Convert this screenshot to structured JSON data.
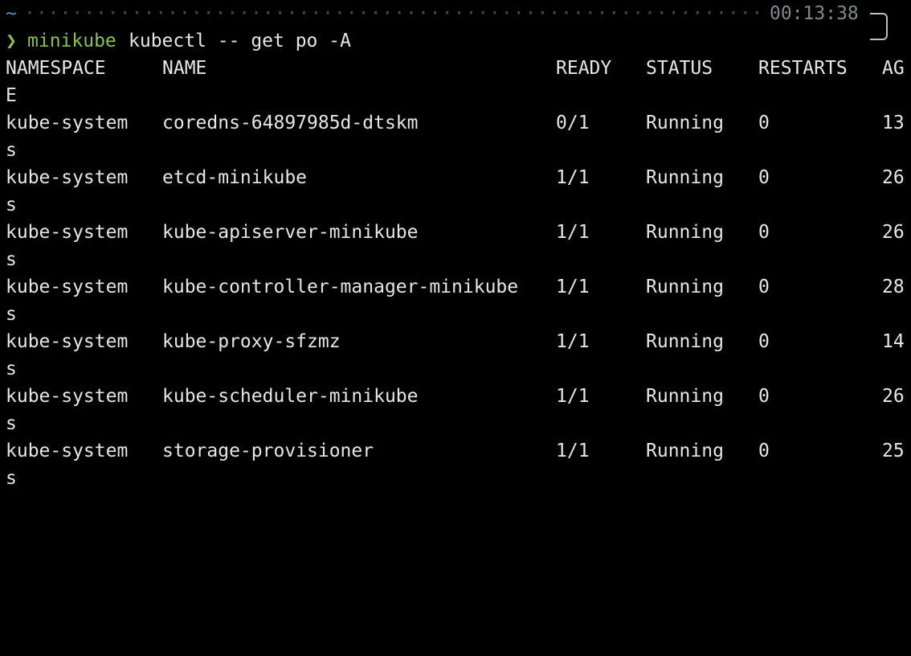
{
  "prompt": {
    "tilde": "~",
    "dots": "···································································································",
    "time": "00:13:38",
    "arrow": "❯",
    "context": "minikube",
    "command": "kubectl -- get po -A"
  },
  "columns": {
    "namespace": "NAMESPACE",
    "name": "NAME",
    "ready": "READY",
    "status": "STATUS",
    "restarts": "RESTARTS",
    "age": "AG",
    "age_wrap": "E"
  },
  "rows": [
    {
      "namespace": "kube-system",
      "name": "coredns-64897985d-dtskm",
      "ready": "0/1",
      "status": "Running",
      "restarts": "0",
      "age": "13",
      "wrap": "s"
    },
    {
      "namespace": "kube-system",
      "name": "etcd-minikube",
      "ready": "1/1",
      "status": "Running",
      "restarts": "0",
      "age": "26",
      "wrap": "s"
    },
    {
      "namespace": "kube-system",
      "name": "kube-apiserver-minikube",
      "ready": "1/1",
      "status": "Running",
      "restarts": "0",
      "age": "26",
      "wrap": "s"
    },
    {
      "namespace": "kube-system",
      "name": "kube-controller-manager-minikube",
      "ready": "1/1",
      "status": "Running",
      "restarts": "0",
      "age": "28",
      "wrap": "s"
    },
    {
      "namespace": "kube-system",
      "name": "kube-proxy-sfzmz",
      "ready": "1/1",
      "status": "Running",
      "restarts": "0",
      "age": "14",
      "wrap": "s"
    },
    {
      "namespace": "kube-system",
      "name": "kube-scheduler-minikube",
      "ready": "1/1",
      "status": "Running",
      "restarts": "0",
      "age": "26",
      "wrap": "s"
    },
    {
      "namespace": "kube-system",
      "name": "storage-provisioner",
      "ready": "1/1",
      "status": "Running",
      "restarts": "0",
      "age": "25",
      "wrap": "s"
    }
  ],
  "colors": {
    "background": "#000000",
    "text": "#e6e6e6",
    "prompt_accent": "#8bc34a",
    "tilde": "#5b8fc4",
    "time": "#7a8a8e"
  }
}
